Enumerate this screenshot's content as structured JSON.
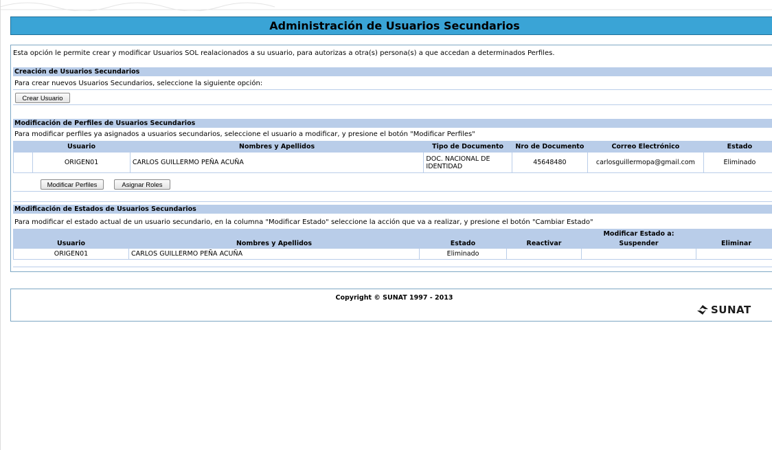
{
  "page": {
    "title": "Administración de Usuarios Secundarios",
    "intro": "Esta opción le permite crear y modificar Usuarios SOL realacionados a su usuario, para autorizas a otra(s) persona(s) a que accedan a determinados Perfiles."
  },
  "creation": {
    "header": "Creación de Usuarios Secundarios",
    "instruction": "Para crear nuevos Usuarios Secundarios, seleccione la siguiente opción:",
    "create_button": "Crear Usuario"
  },
  "profiles": {
    "header": "Modificación de Perfiles de Usuarios Secundarios",
    "instruction": "Para modificar perfiles ya asignados a usuarios secundarios, seleccione el usuario a modificar, y presione el botón \"Modificar Perfiles\"",
    "columns": [
      "Usuario",
      "Nombres y Apellidos",
      "Tipo de Documento",
      "Nro de Documento",
      "Correo Electrónico",
      "Estado"
    ],
    "rows": [
      {
        "usuario": "ORIGEN01",
        "nombres": "CARLOS GUILLERMO  PEÑA ACUÑA",
        "tipo_doc": "DOC. NACIONAL DE IDENTIDAD",
        "nro_doc": "45648480",
        "correo": "carlosguillermopa@gmail.com",
        "estado": "Eliminado"
      }
    ],
    "modify_button": "Modificar Perfiles",
    "assign_button": "Asignar Roles"
  },
  "states": {
    "header": "Modificación de Estados de Usuarios Secundarios",
    "instruction": "Para modificar el estado actual de un usuario secundario, en la columna \"Modificar Estado\" seleccione la acción que va a realizar, y presione el botón \"Cambiar Estado\"",
    "group_header": "Modificar Estado a:",
    "columns": [
      "Usuario",
      "Nombres y Apellidos",
      "Estado",
      "Reactivar",
      "Suspender",
      "Eliminar"
    ],
    "rows": [
      {
        "usuario": "ORIGEN01",
        "nombres": "CARLOS GUILLERMO  PEÑA ACUÑA",
        "estado": "Eliminado"
      }
    ]
  },
  "footer": {
    "copyright": "Copyright © SUNAT 1997 - 2013",
    "logo_text": "SUNAT"
  },
  "colors": {
    "title_bar": "#3aa4d6",
    "section_header": "#b9cde9"
  }
}
